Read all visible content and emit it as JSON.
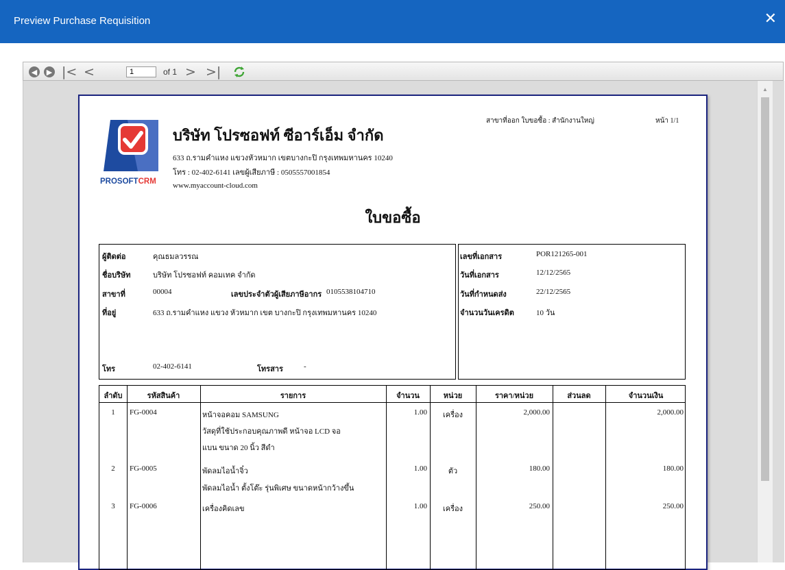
{
  "window": {
    "title": "Preview Purchase Requisition",
    "close_label": "✕"
  },
  "toolbar": {
    "page_value": "1",
    "of_label": "of 1"
  },
  "report": {
    "company_name": "บริษัท โปรซอฟท์ ซีอาร์เอ็ม จำกัด",
    "address": "633 ถ.รามคำแหง แขวงหัวหมาก เขตบางกะปิ กรุงเทพมหานคร 10240",
    "phone_tax": "โทร : 02-402-6141 เลขผู้เสียภาษี : 0505557001854",
    "website": "www.myaccount-cloud.com",
    "logo_prefix": "PROSOFT",
    "logo_suffix": "CRM",
    "branch_label": "สาขาที่ออก ใบขอซื้อ : สำนักงานใหญ่",
    "page_label": "หน้า 1/1",
    "doc_title": "ใบขอซื้อ",
    "contact": {
      "contact_label": "ผู้ติดต่อ",
      "contact_value": "คุณธมลวรรณ",
      "company_label": "ชื่อบริษัท",
      "company_value": "บริษัท โปรซอฟท์ คอมเทค จำกัด",
      "branch_label": "สาขาที่",
      "branch_value": "00004",
      "taxid_label": "เลขประจำตัวผู้เสียภาษีอากร",
      "taxid_value": "0105538104710",
      "address_label": "ที่อยู่",
      "address_value": "633 ถ.รามคำแหง แขวง หัวหมาก เขต บางกะปิ กรุงเทพมหานคร 10240",
      "phone_label": "โทร",
      "phone_value": "02-402-6141",
      "fax_label": "โทรสาร",
      "fax_value": "-"
    },
    "docinfo": {
      "docno_label": "เลขที่เอกสาร",
      "docno_value": "POR121265-001",
      "docdate_label": "วันที่เอกสาร",
      "docdate_value": "12/12/2565",
      "due_label": "วันที่กำหนดส่ง",
      "due_value": "22/12/2565",
      "credit_label": "จำนวนวันเครดิต",
      "credit_value": "10 วัน"
    },
    "columns": [
      "ลำดับ",
      "รหัสสินค้า",
      "รายการ",
      "จำนวน",
      "หน่วย",
      "ราคา/หน่วย",
      "ส่วนลด",
      "จำนวนเงิน"
    ],
    "rows": [
      {
        "no": "1",
        "code": "FG-0004",
        "name": "หน้าจอคอม SAMSUNG",
        "desc1": "วัสดุที่ใช้ประกอบคุณภาพดี หน้าจอ LCD จอ",
        "desc2": "แบน ขนาด 20 นิ้ว สีดำ",
        "qty": "1.00",
        "unit": "เครื่อง",
        "price": "2,000.00",
        "discount": "",
        "amount": "2,000.00"
      },
      {
        "no": "2",
        "code": "FG-0005",
        "name": "พัดลมไอน้ำจิ๋ว",
        "desc1": "พัดลมไอน้ำ ตั้งโต๊ะ รุ่นพิเศษ ขนาดหน้ากว้างขึ้น",
        "desc2": "",
        "qty": "1.00",
        "unit": "ตัว",
        "price": "180.00",
        "discount": "",
        "amount": "180.00"
      },
      {
        "no": "3",
        "code": "FG-0006",
        "name": "เครื่องคิดเลข",
        "desc1": "",
        "desc2": "",
        "qty": "1.00",
        "unit": "เครื่อง",
        "price": "250.00",
        "discount": "",
        "amount": "250.00"
      }
    ]
  },
  "colors": {
    "titlebar": "#1565c0",
    "paper_border": "#1a237e",
    "logo_red": "#e53935",
    "logo_blue": "#1e4ba0"
  }
}
